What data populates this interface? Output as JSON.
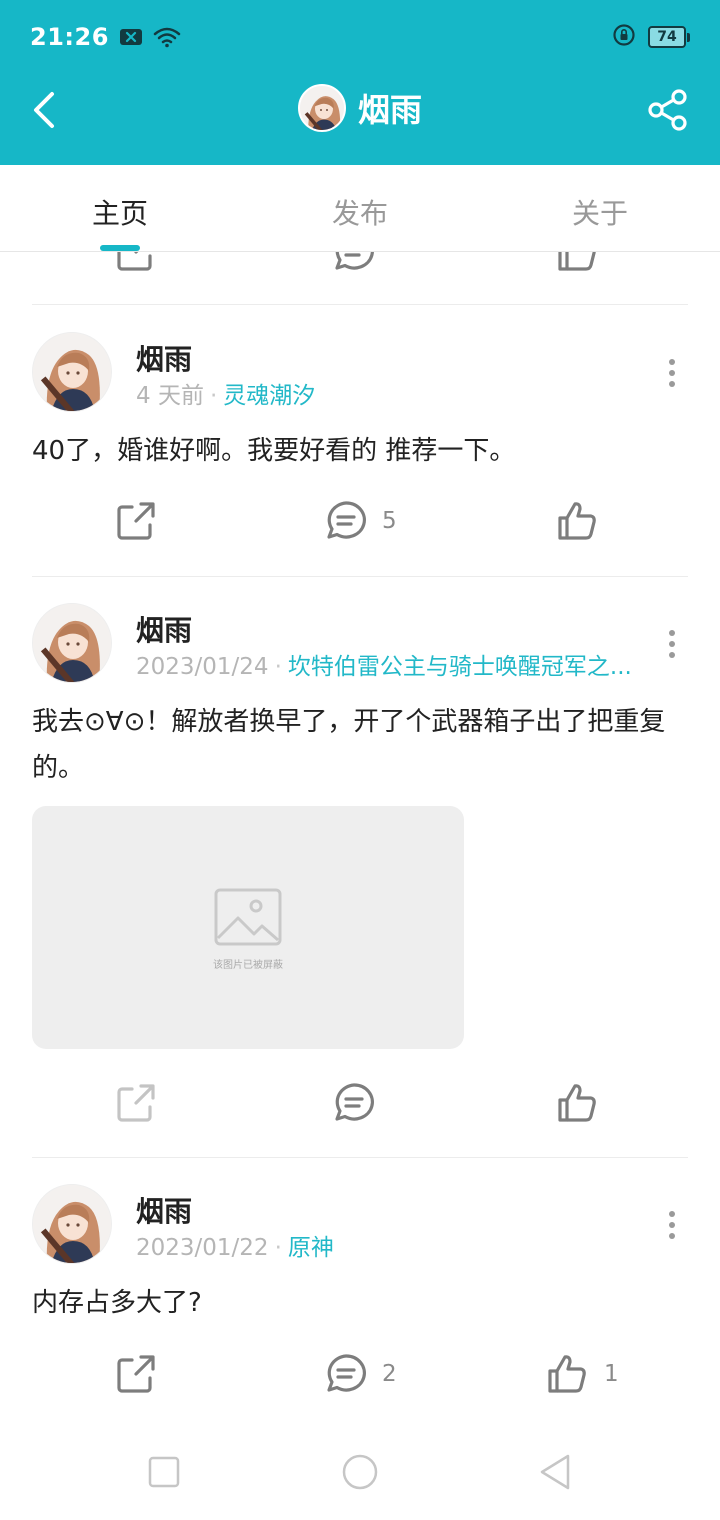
{
  "status": {
    "time": "21:26",
    "battery": "74"
  },
  "header": {
    "title": "烟雨"
  },
  "tabs": [
    {
      "label": "主页"
    },
    {
      "label": "发布"
    },
    {
      "label": "关于"
    }
  ],
  "posts": [
    {
      "author": "烟雨",
      "date": "4 天前",
      "topic": "灵魂潮汐",
      "content": "40了，婚谁好啊。我要好看的 推荐一下。",
      "comments": "5",
      "likes": ""
    },
    {
      "author": "烟雨",
      "date": "2023/01/24",
      "topic": "坎特伯雷公主与骑士唤醒冠军之...",
      "content": "我去⊙∀⊙！解放者换早了，开了个武器箱子出了把重复的。",
      "image_caption": "该图片已被屏蔽",
      "comments": "",
      "likes": ""
    },
    {
      "author": "烟雨",
      "date": "2023/01/22",
      "topic": "原神",
      "content": "内存占多大了?",
      "comments": "2",
      "likes": "1"
    }
  ],
  "colors": {
    "accent": "#16b7c7",
    "topic": "#22b8c8"
  }
}
